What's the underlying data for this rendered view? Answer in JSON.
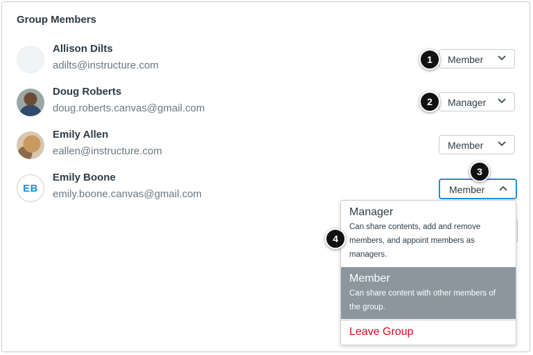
{
  "panel": {
    "title": "Group Members"
  },
  "members": [
    {
      "name": "Allison Dilts",
      "email": "adilts@instructure.com",
      "role": "Member",
      "badge": "1"
    },
    {
      "name": "Doug Roberts",
      "email": "doug.roberts.canvas@gmail.com",
      "role": "Manager",
      "badge": "2"
    },
    {
      "name": "Emily Allen",
      "email": "eallen@instructure.com",
      "role": "Member",
      "badge": ""
    },
    {
      "name": "Emily Boone",
      "email": "emily.boone.canvas@gmail.com",
      "role": "Member",
      "badge": "3",
      "initials": "EB"
    }
  ],
  "role_menu": {
    "options": [
      {
        "title": "Manager",
        "description": "Can share contents, add and remove members, and appoint members as managers.",
        "selected": false
      },
      {
        "title": "Member",
        "description": "Can share content with other members of the group.",
        "selected": true
      },
      {
        "title": "Leave Group",
        "description": "",
        "selected": false
      }
    ],
    "badge": "4"
  },
  "colors": {
    "accent": "#1b8fd6",
    "danger": "#e0061f",
    "selected_bg": "#8b969e",
    "text": "#2d3b45",
    "muted": "#6b7780"
  },
  "icons": {
    "dropdown_closed": "chevron-down-icon",
    "dropdown_open": "chevron-up-icon"
  }
}
